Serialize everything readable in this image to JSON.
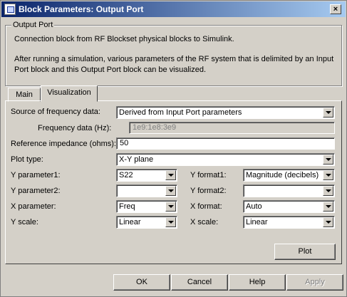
{
  "window": {
    "title": "Block Parameters: Output Port",
    "close": "×"
  },
  "group": {
    "label": "Output Port",
    "line1": "Connection block from RF Blockset physical blocks to Simulink.",
    "line2": "After running a simulation, various parameters of the RF system that is delimited by an Input Port block and this Output Port block can be visualized."
  },
  "tabs": {
    "main": "Main",
    "visualization": "Visualization"
  },
  "form": {
    "source_label": "Source of frequency data:",
    "source_value": "Derived from Input Port parameters",
    "freq_label": "Frequency data (Hz):",
    "freq_value": "1e9:1e8:3e9",
    "ref_label": "Reference impedance (ohms):",
    "ref_value": "50",
    "plot_type_label": "Plot type:",
    "plot_type_value": "X-Y plane",
    "y_param1_label": "Y parameter1:",
    "y_param1_value": "S22",
    "y_format1_label": "Y format1:",
    "y_format1_value": "Magnitude (decibels)",
    "y_param2_label": "Y parameter2:",
    "y_param2_value": "",
    "y_format2_label": "Y format2:",
    "y_format2_value": "",
    "x_param_label": "X parameter:",
    "x_param_value": "Freq",
    "x_format_label": "X format:",
    "x_format_value": "Auto",
    "y_scale_label": "Y scale:",
    "y_scale_value": "Linear",
    "x_scale_label": "X scale:",
    "x_scale_value": "Linear",
    "plot_button": "Plot"
  },
  "buttons": {
    "ok": "OK",
    "cancel": "Cancel",
    "help": "Help",
    "apply": "Apply"
  }
}
